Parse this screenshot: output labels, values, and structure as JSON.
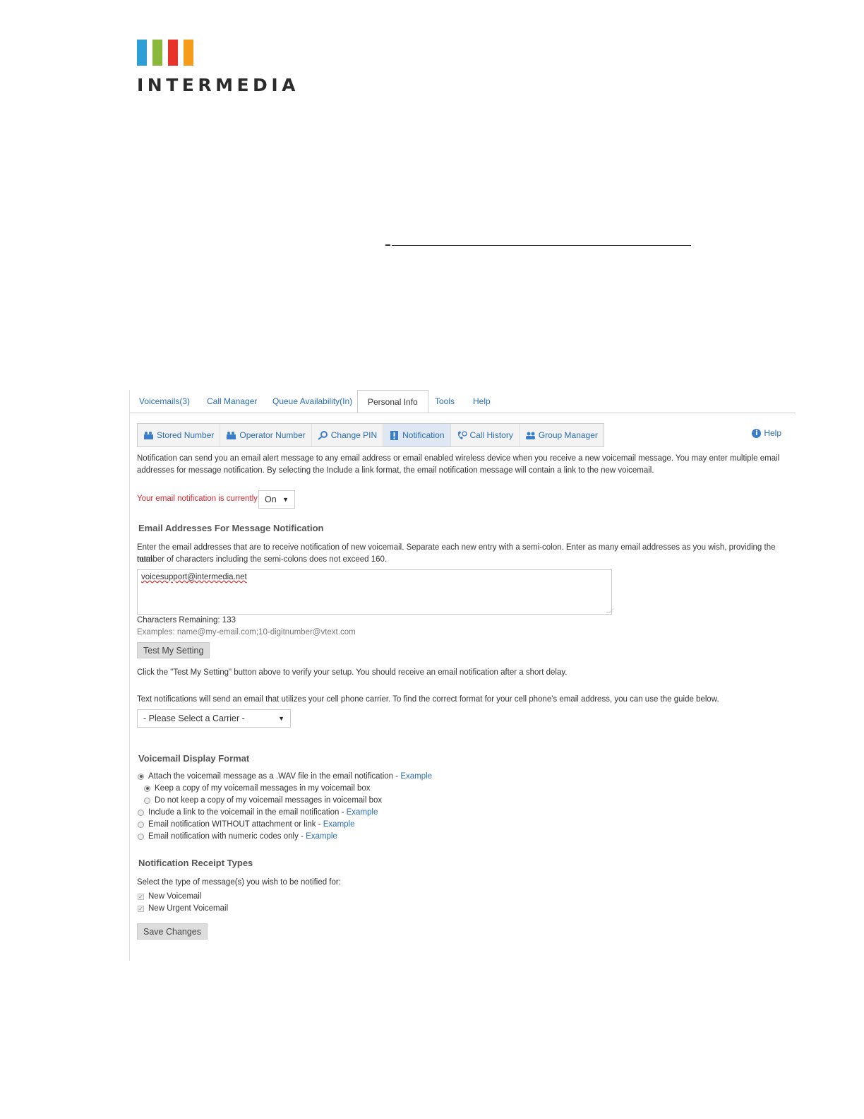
{
  "brand": {
    "logo_text": "INTERMEDIA",
    "bar_colors": [
      "#2e9fd6",
      "#8ab83a",
      "#e8332b",
      "#f59c1c"
    ]
  },
  "topnav": {
    "tabs": [
      {
        "label": "Voicemails(3)"
      },
      {
        "label": "Call Manager"
      },
      {
        "label": "Queue Availability(In)"
      },
      {
        "label": "Personal Info",
        "active": true
      },
      {
        "label": "Tools"
      },
      {
        "label": "Help"
      }
    ]
  },
  "subnav": {
    "items": [
      {
        "label": "Stored Number",
        "icon": "stored-number-icon"
      },
      {
        "label": "Operator Number",
        "icon": "operator-number-icon"
      },
      {
        "label": "Change PIN",
        "icon": "change-pin-icon"
      },
      {
        "label": "Notification",
        "icon": "notification-icon",
        "active": true
      },
      {
        "label": "Call History",
        "icon": "call-history-icon"
      },
      {
        "label": "Group Manager",
        "icon": "group-manager-icon"
      }
    ],
    "help_label": "Help"
  },
  "intro": {
    "line1": "Notification can send you an email alert message to any email address or email enabled wireless device when you receive a new voicemail message. You may enter multiple email",
    "line2": "addresses for message notification. By selecting the Include a link format, the email notification message will contain a link to the new voicemail."
  },
  "status": {
    "label": "Your email notification is currently",
    "value": "On"
  },
  "email_section": {
    "heading": "Email Addresses For Message Notification",
    "desc_line1": "Enter the email addresses that are to receive notification of new voicemail. Separate each new entry with a semi-colon. Enter as many email addresses as you wish, providing the total",
    "desc_line2": "number of characters including the semi-colons does not exceed 160.",
    "value": "voicesupport@intermedia.net",
    "chars_remaining": "Characters Remaining: 133",
    "examples": "Examples: name@my-email.com;10-digitnumber@vtext.com",
    "test_button": "Test My Setting",
    "test_desc": "Click the \"Test My Setting\" button above to verify your setup. You should receive an email notification after a short delay.",
    "text_desc": "Text notifications will send an email that utilizes your cell phone carrier. To find the correct format for your cell phone's email address, you can use the guide below.",
    "carrier_select": "- Please Select a Carrier -"
  },
  "format_section": {
    "heading": "Voicemail Display Format",
    "options": [
      {
        "label": "Attach the voicemail message as a .WAV file in the email notification - ",
        "link": "Example",
        "checked": true
      },
      {
        "label": "Keep a copy of my voicemail messages in my voicemail box",
        "checked": true
      },
      {
        "label": "Do not keep a copy of my voicemail messages in voicemail box",
        "checked": false
      },
      {
        "label": "Include a link to the voicemail in the email notification - ",
        "link": "Example",
        "checked": false
      },
      {
        "label": "Email notification WITHOUT attachment or link - ",
        "link": "Example",
        "checked": false
      },
      {
        "label": "Email notification with numeric codes only - ",
        "link": "Example",
        "checked": false
      }
    ]
  },
  "receipt_section": {
    "heading": "Notification Receipt Types",
    "desc": "Select the type of message(s) you wish to be notified for:",
    "items": [
      {
        "label": "New Voicemail",
        "checked": true
      },
      {
        "label": "New Urgent Voicemail",
        "checked": true
      }
    ],
    "save_button": "Save Changes"
  }
}
